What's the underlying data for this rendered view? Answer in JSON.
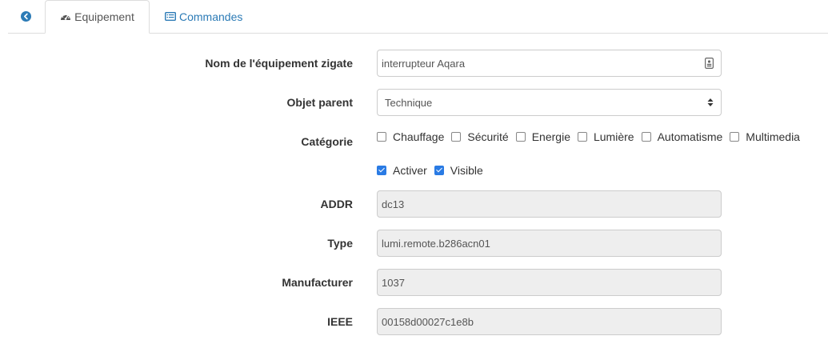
{
  "tabs": {
    "back_icon": "circle-arrow-left-icon",
    "equipment": {
      "icon": "tachometer-icon",
      "label": "Equipement"
    },
    "commands": {
      "icon": "list-alt-icon",
      "label": "Commandes"
    }
  },
  "form": {
    "name": {
      "label": "Nom de l'équipement zigate",
      "value": "interrupteur Aqara",
      "icon": "id-card-icon"
    },
    "parent": {
      "label": "Objet parent",
      "value": "Technique"
    },
    "category": {
      "label": "Catégorie",
      "options": [
        {
          "label": "Chauffage",
          "checked": false
        },
        {
          "label": "Sécurité",
          "checked": false
        },
        {
          "label": "Energie",
          "checked": false
        },
        {
          "label": "Lumière",
          "checked": false
        },
        {
          "label": "Automatisme",
          "checked": false
        },
        {
          "label": "Multimedia",
          "checked": false
        }
      ]
    },
    "flags": [
      {
        "label": "Activer",
        "checked": true
      },
      {
        "label": "Visible",
        "checked": true
      }
    ],
    "addr": {
      "label": "ADDR",
      "value": "dc13"
    },
    "type": {
      "label": "Type",
      "value": "lumi.remote.b286acn01"
    },
    "manufacturer": {
      "label": "Manufacturer",
      "value": "1037"
    },
    "ieee": {
      "label": "IEEE",
      "value": "00158d00027c1e8b"
    }
  },
  "colors": {
    "accent": "#2c7bb6",
    "checkbox": "#2a7be4",
    "readonly_bg": "#eeeeee"
  }
}
